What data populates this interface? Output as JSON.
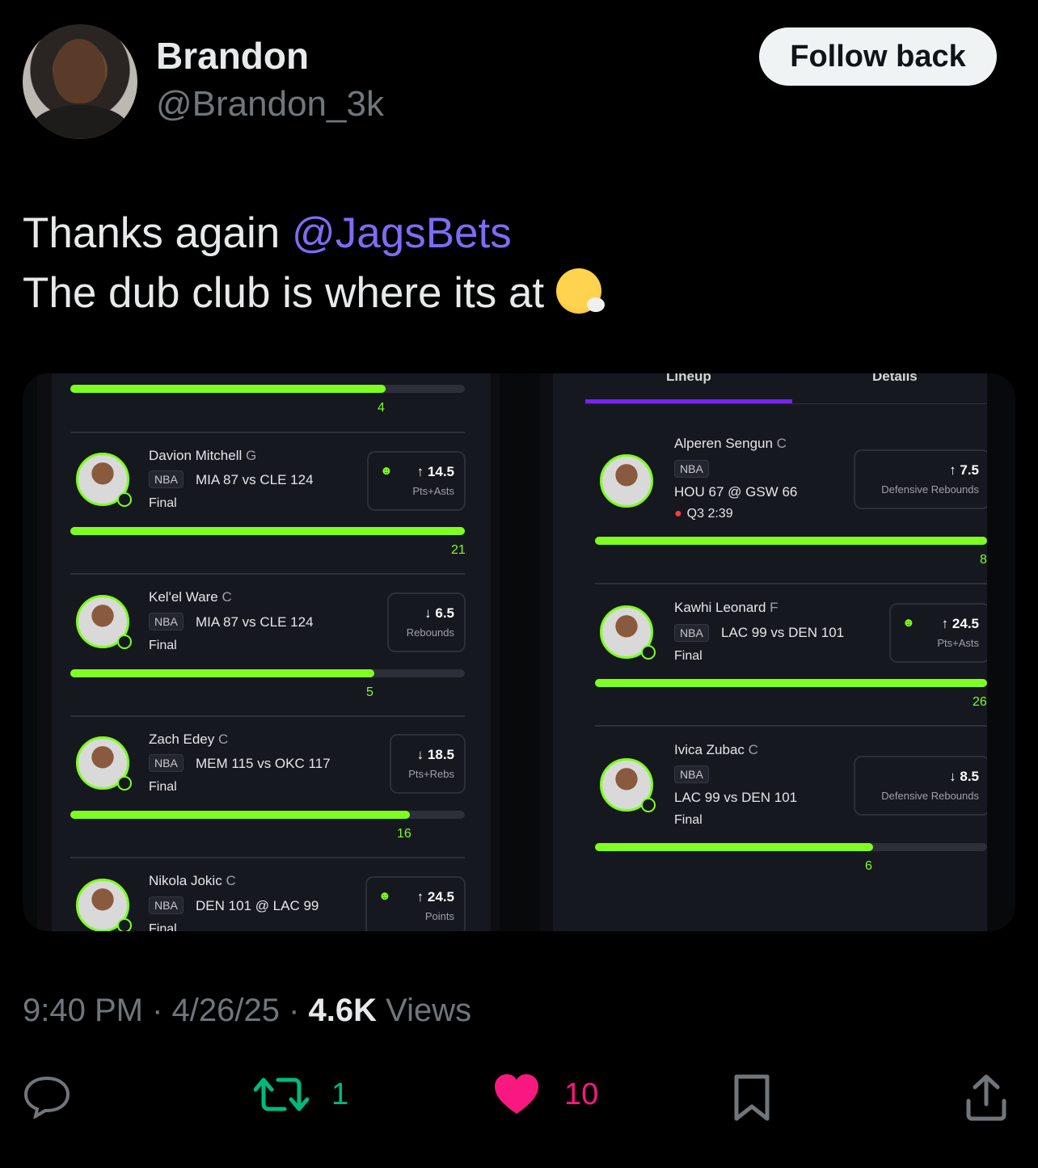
{
  "author": {
    "name": "Brandon",
    "handle": "@Brandon_3k"
  },
  "follow_label": "Follow back",
  "tweet": {
    "line1_prefix": "Thanks again ",
    "mention": "@JagsBets",
    "line2": "The dub club is where its at"
  },
  "media": {
    "left": {
      "top_bar_value": "4",
      "players": [
        {
          "name": "Davion Mitchell",
          "pos": "G",
          "league": "NBA",
          "game": "MIA 87 vs CLE 124",
          "status": "Final",
          "direction": "↑",
          "line": "14.5",
          "stat": "Pts+Asts",
          "result": "21",
          "progress": 1.0
        },
        {
          "name": "Kel'el Ware",
          "pos": "C",
          "league": "NBA",
          "game": "MIA 87 vs CLE 124",
          "status": "Final",
          "direction": "↓",
          "line": "6.5",
          "stat": "Rebounds",
          "result": "5",
          "progress": 0.77
        },
        {
          "name": "Zach Edey",
          "pos": "C",
          "league": "NBA",
          "game": "MEM 115 vs OKC 117",
          "status": "Final",
          "direction": "↓",
          "line": "18.5",
          "stat": "Pts+Rebs",
          "result": "16",
          "progress": 0.86
        },
        {
          "name": "Nikola Jokic",
          "pos": "C",
          "league": "NBA",
          "game": "DEN 101 @ LAC 99",
          "status": "Final",
          "direction": "↑",
          "line": "24.5",
          "stat": "Points"
        }
      ]
    },
    "right": {
      "tabs": [
        "Lineup",
        "Details"
      ],
      "players": [
        {
          "name": "Alperen Sengun",
          "pos": "C",
          "league": "NBA",
          "game": "HOU 67 @ GSW 66",
          "status": "Q3 2:39",
          "direction": "↑",
          "line": "7.5",
          "stat": "Defensive Rebounds",
          "result": "8",
          "progress": 1.0
        },
        {
          "name": "Kawhi Leonard",
          "pos": "F",
          "league": "NBA",
          "game": "LAC 99 vs DEN 101",
          "status": "Final",
          "direction": "↑",
          "line": "24.5",
          "stat": "Pts+Asts",
          "result": "26",
          "progress": 1.0
        },
        {
          "name": "Ivica Zubac",
          "pos": "C",
          "league": "NBA",
          "game": "LAC 99 vs DEN 101",
          "status": "Final",
          "direction": "↓",
          "line": "8.5",
          "stat": "Defensive Rebounds",
          "result": "6",
          "progress": 0.71
        }
      ]
    }
  },
  "meta": {
    "time": "9:40 PM",
    "date": "4/26/25",
    "views_count": "4.6K",
    "views_label": "Views"
  },
  "actions": {
    "reposts": "1",
    "likes": "10"
  },
  "icons": [
    "reply-icon",
    "repost-icon",
    "heart-icon",
    "bookmark-icon",
    "share-icon"
  ],
  "colors": {
    "accent": "#7d6cf4",
    "progress": "#7fff1f",
    "like": "#f91880",
    "repost": "#00ba7c",
    "tab": "#7a22f5"
  }
}
